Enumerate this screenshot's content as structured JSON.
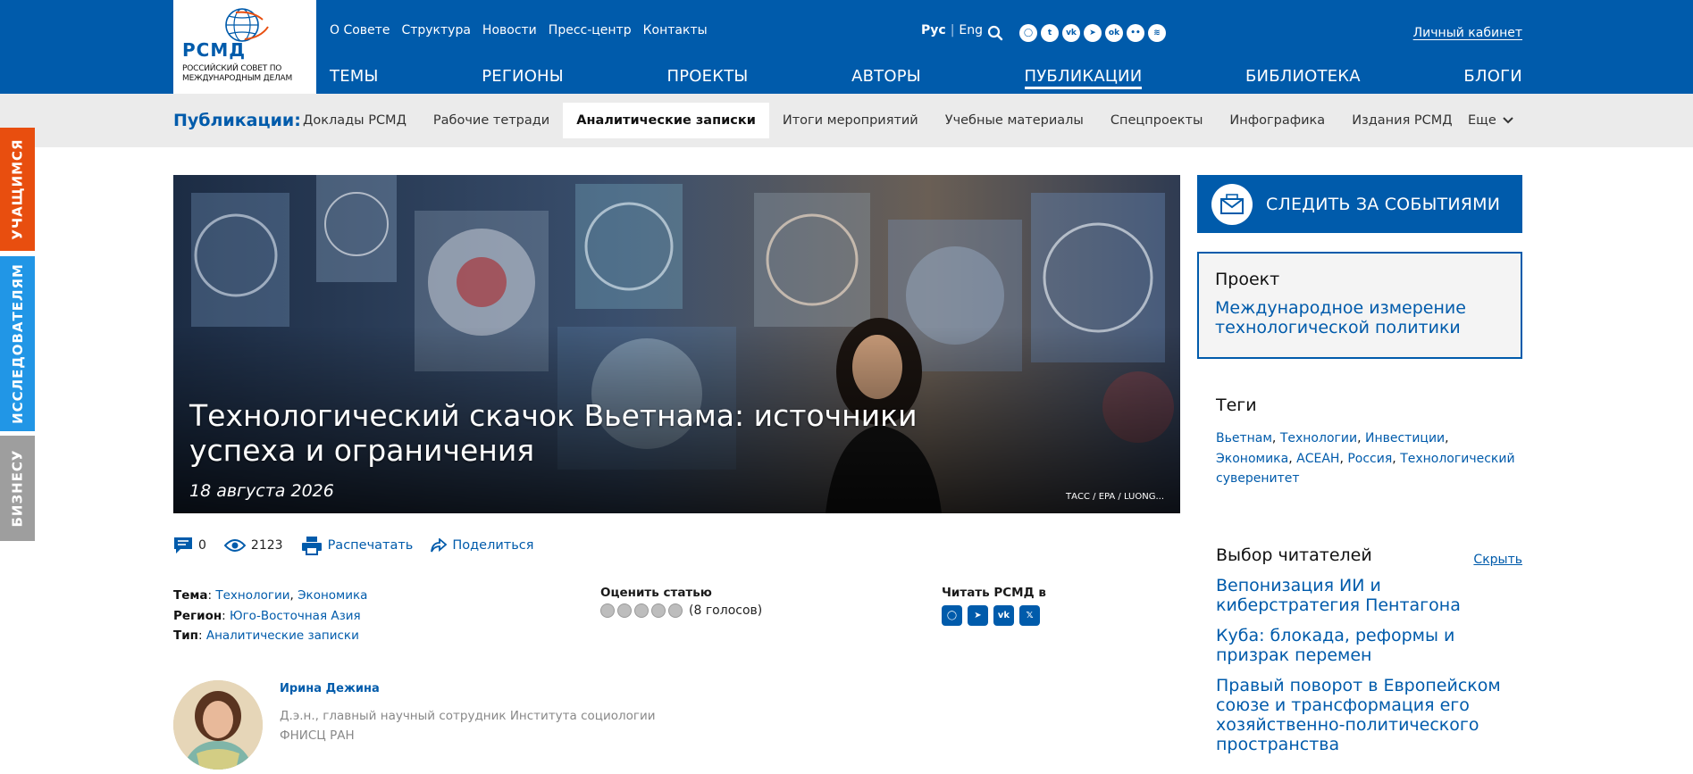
{
  "logo": {
    "abbr": "РСМД",
    "full": "РОССИЙСКИЙ СОВЕТ ПО МЕЖДУНАРОДНЫМ ДЕЛАМ"
  },
  "topnav": [
    "О Совете",
    "Структура",
    "Новости",
    "Пресс-центр",
    "Контакты"
  ],
  "lang": {
    "ru": "Рус",
    "sep": "|",
    "en": "Eng"
  },
  "socials": [
    {
      "name": "max-icon",
      "glyph": "◯"
    },
    {
      "name": "twitter-icon",
      "glyph": "t"
    },
    {
      "name": "vk-icon",
      "glyph": "vk"
    },
    {
      "name": "telegram-icon",
      "glyph": "➤"
    },
    {
      "name": "odnoklassniki-icon",
      "glyph": "ok"
    },
    {
      "name": "flickr-icon",
      "glyph": "••"
    },
    {
      "name": "rss-icon",
      "glyph": "≋"
    }
  ],
  "cabinet": "Личный кабинет",
  "mainnav": [
    "ТЕМЫ",
    "РЕГИОНЫ",
    "ПРОЕКТЫ",
    "АВТОРЫ",
    "ПУБЛИКАЦИИ",
    "БИБЛИОТЕКА",
    "БЛОГИ"
  ],
  "mainnav_active": "ПУБЛИКАЦИИ",
  "subnav": {
    "title": "Публикации:",
    "items": [
      "Доклады РСМД",
      "Рабочие тетради",
      "Аналитические записки",
      "Итоги мероприятий",
      "Учебные материалы",
      "Спецпроекты",
      "Инфографика",
      "Издания РСМД"
    ],
    "active": "Аналитические записки",
    "more": "Еще"
  },
  "sidetabs": {
    "students": "УЧАЩИМСЯ",
    "researchers": "ИССЛЕДОВАТЕЛЯМ",
    "business": "БИЗНЕСУ"
  },
  "article": {
    "title": "Технологический скачок Вьетнама: источники успеха и ограничения",
    "date": "18 августа 2026",
    "photo_credit": "ТАСС / EPA / LUONG...",
    "comments": "0",
    "views": "2123",
    "print": "Распечатать",
    "share": "Поделиться",
    "theme_label": "Тема",
    "themes": [
      "Технологии",
      "Экономика"
    ],
    "region_label": "Регион",
    "region": "Юго-Восточная Азия",
    "type_label": "Тип",
    "type": "Аналитические записки",
    "rate_label": "Оценить статью",
    "votes": "(8 голосов)",
    "rating_stars": 5,
    "read_label": "Читать РСМД в",
    "read_channels": [
      {
        "name": "max-channel-icon",
        "glyph": "◯"
      },
      {
        "name": "telegram-channel-icon",
        "glyph": "➤"
      },
      {
        "name": "vk-channel-icon",
        "glyph": "vk"
      },
      {
        "name": "x-channel-icon",
        "glyph": "𝕏"
      }
    ]
  },
  "author": {
    "name": "Ирина Дежина",
    "description": "Д.э.н., главный научный сотрудник Института социологии ФНИСЦ РАН"
  },
  "sidebar": {
    "follow": "СЛЕДИТЬ ЗА СОБЫТИЯМИ",
    "project_label": "Проект",
    "project_title": "Международное измерение технологической политики",
    "tags_title": "Теги",
    "tags": [
      "Вьетнам",
      "Технологии",
      "Инвестиции",
      "Экономика",
      "АСЕАН",
      "Россия",
      "Технологический суверенитет"
    ],
    "choice_title": "Выбор читателей",
    "choice_hide": "Скрыть",
    "choice_items": [
      "Вепонизация ИИ и киберстратегия Пентагона",
      "Куба: блокада, реформы и призрак перемен",
      "Правый поворот в Европейском союзе и трансформация его хозяйственно-политического пространства"
    ]
  },
  "colors": {
    "brand": "#005bab",
    "orange": "#e84e0f",
    "light_blue": "#2196e6",
    "gray": "#9e9e9e"
  }
}
